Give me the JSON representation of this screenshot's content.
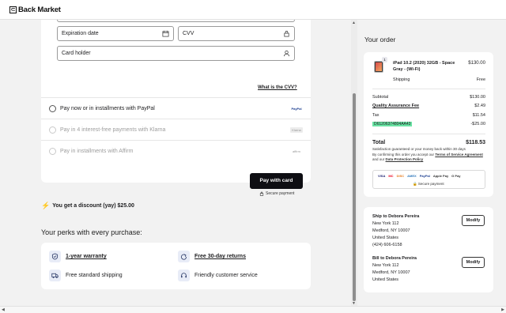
{
  "brand": {
    "logo_text": "Back Market"
  },
  "payment": {
    "expiration_placeholder": "Expiration date",
    "cvv_placeholder": "CVV",
    "card_holder_placeholder": "Card holder",
    "cvv_link": "What is the CVV?",
    "options": [
      {
        "label": "Pay now or in installments with PayPal",
        "logo": "PayPal",
        "enabled": true
      },
      {
        "label": "Pay in 4 interest-free payments with Klarna",
        "logo": "Klarna",
        "enabled": false
      },
      {
        "label": "Pay in installments with Affirm",
        "logo": "affirm",
        "enabled": false
      }
    ],
    "pay_button": "Pay with card",
    "secure_label": "Secure payment"
  },
  "discount": {
    "text": "You get a discount (yay) $25.00"
  },
  "perks": {
    "title": "Your perks with every purchase:",
    "items": [
      {
        "label": "1-year warranty",
        "icon": "shield-check-icon",
        "link": true
      },
      {
        "label": "Free 30-day returns",
        "icon": "return-arrow-icon",
        "link": true
      },
      {
        "label": "Free standard shipping",
        "icon": "truck-icon",
        "link": false
      },
      {
        "label": "Friendly customer service",
        "icon": "headset-icon",
        "link": false
      }
    ]
  },
  "order": {
    "title": "Your order",
    "product": {
      "quantity": "1",
      "name": "iPad 10.2 (2020) 32GB - Space Gray - (Wi-Fi)",
      "price": "$130.00"
    },
    "shipping_label": "Shipping",
    "shipping_value": "Free",
    "subtotal_label": "Subtotal",
    "subtotal_value": "$130.00",
    "quality_label": "Quality Assurance Fee",
    "quality_value": "$2.49",
    "tax_label": "Tax",
    "tax_value": "$11.54",
    "promo_code": "D61206374804AA43",
    "promo_value": "-$25.00",
    "total_label": "Total",
    "total_value": "$118.53",
    "legal_line1": "Satisfaction guaranteed or your money back within 30 days",
    "legal_line2": "By confirming this order you accept our",
    "terms_link": "Terms of Service Agreement",
    "legal_and": "and our",
    "privacy_link": "Data Protection Policy",
    "card_brands": [
      "VISA",
      "MC",
      "DISC",
      "AMEX",
      "PayPal",
      "Apple Pay",
      "G Pay"
    ],
    "secure_label": "Secure payment"
  },
  "shipping_address": {
    "heading": "Ship to Debora Pereira",
    "line1": "New York 112",
    "line2": "Medford, NY 10007",
    "line3": "United States",
    "phone": "(424) 606-6158",
    "modify": "Modify"
  },
  "billing_address": {
    "heading": "Bill to Debora Pereira",
    "line1": "New York 112",
    "line2": "Medford, NY 10007",
    "line3": "United States",
    "modify": "Modify"
  },
  "colors": {
    "accent_dark": "#0e0e13",
    "promo_highlight": "#69e3a3",
    "background": "#f2f2f2"
  }
}
